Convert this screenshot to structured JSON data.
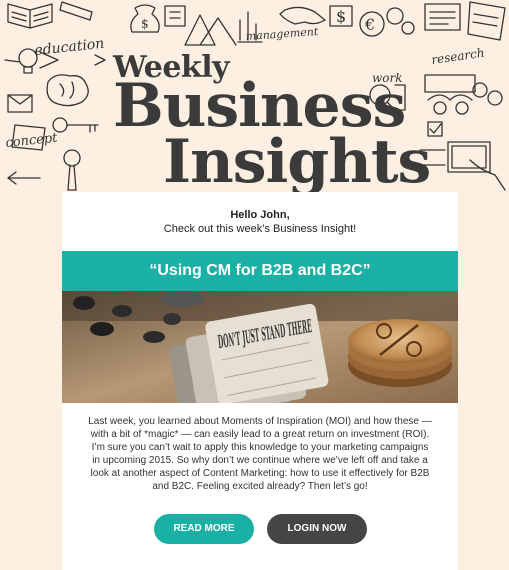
{
  "header": {
    "title_line1": "Weekly",
    "title_line2": "Business",
    "title_line3": "Insights",
    "doodle_words": [
      "education",
      "management",
      "work",
      "research",
      "concept"
    ]
  },
  "email": {
    "greeting_name": "Hello John,",
    "greeting_sub": "Check out this week’s Business Insight!",
    "headline": "“Using CM for B2B and B2C”",
    "photo_text": "DON'T JUST STAND THERE",
    "body": "Last week, you learned about Moments of Inspiration (MOI) and how these — with a bit of *magic* — can easily lead to a great return on investment (ROI). I’m sure you can’t wait to apply this knowledge to your marketing campaigns in upcoming 2015. So why don’t we continue where we’ve left off and take a look at another aspect of Content Marketing: how to use it effectively for B2B and B2C. Feeling excited already? Then let’s go!",
    "buttons": {
      "read_more": "READ MORE",
      "login_now": "LOGIN NOW"
    }
  },
  "colors": {
    "accent": "#1bb0a5",
    "dark_button": "#454545",
    "background": "#fdf0e3",
    "headline_text": "#3b3b3b"
  }
}
